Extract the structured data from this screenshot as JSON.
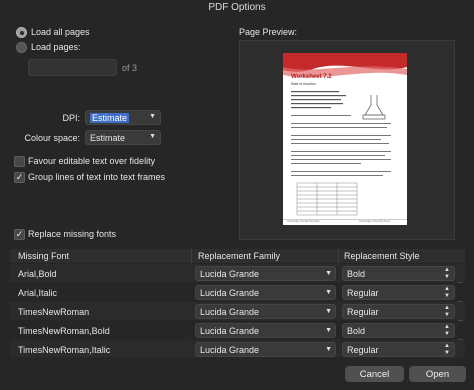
{
  "window": {
    "title": "PDF Options"
  },
  "pages": {
    "load_all_label": "Load all pages",
    "load_pages_label": "Load pages:",
    "range_value": "",
    "of_label": "of 3"
  },
  "dpi": {
    "label": "DPI:",
    "value": "Estimate"
  },
  "colour_space": {
    "label": "Colour space:",
    "value": "Estimate"
  },
  "options": {
    "favour_editable": "Favour editable text over fidelity",
    "favour_editable_checked": false,
    "group_lines": "Group lines of text into text frames",
    "group_lines_checked": true,
    "replace_fonts": "Replace missing fonts",
    "replace_fonts_checked": true
  },
  "preview": {
    "label": "Page Preview:",
    "doc_title": "Worksheet 7.2",
    "doc_subtitle": "Rate of reaction",
    "footer_left": "Cambridge IGCSE Chemistry",
    "footer_right": "Cambridge University Press"
  },
  "table": {
    "headers": [
      "Missing Font",
      "Replacement Family",
      "Replacement Style"
    ],
    "rows": [
      {
        "missing": "Arial,Bold",
        "family": "Lucida Grande",
        "style": "Bold"
      },
      {
        "missing": "Arial,Italic",
        "family": "Lucida Grande",
        "style": "Regular"
      },
      {
        "missing": "TimesNewRoman",
        "family": "Lucida Grande",
        "style": "Regular"
      },
      {
        "missing": "TimesNewRoman,Bold",
        "family": "Lucida Grande",
        "style": "Bold"
      },
      {
        "missing": "TimesNewRoman,Italic",
        "family": "Lucida Grande",
        "style": "Regular"
      }
    ]
  },
  "buttons": {
    "cancel": "Cancel",
    "open": "Open"
  },
  "colors": {
    "accent": "#3f6ec9",
    "panel": "#262626"
  }
}
